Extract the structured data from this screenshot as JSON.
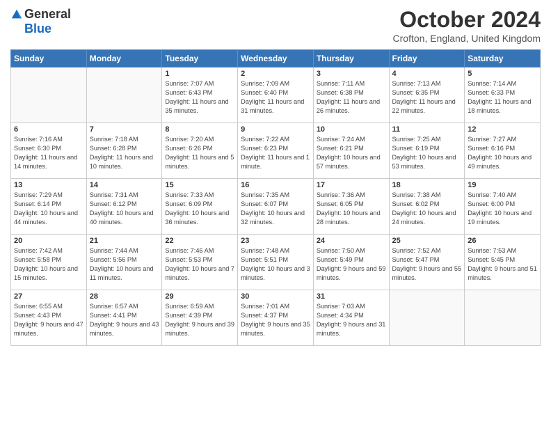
{
  "logo": {
    "general": "General",
    "blue": "Blue"
  },
  "title": "October 2024",
  "location": "Crofton, England, United Kingdom",
  "days_of_week": [
    "Sunday",
    "Monday",
    "Tuesday",
    "Wednesday",
    "Thursday",
    "Friday",
    "Saturday"
  ],
  "weeks": [
    [
      {
        "day": "",
        "info": ""
      },
      {
        "day": "",
        "info": ""
      },
      {
        "day": "1",
        "info": "Sunrise: 7:07 AM\nSunset: 6:43 PM\nDaylight: 11 hours and 35 minutes."
      },
      {
        "day": "2",
        "info": "Sunrise: 7:09 AM\nSunset: 6:40 PM\nDaylight: 11 hours and 31 minutes."
      },
      {
        "day": "3",
        "info": "Sunrise: 7:11 AM\nSunset: 6:38 PM\nDaylight: 11 hours and 26 minutes."
      },
      {
        "day": "4",
        "info": "Sunrise: 7:13 AM\nSunset: 6:35 PM\nDaylight: 11 hours and 22 minutes."
      },
      {
        "day": "5",
        "info": "Sunrise: 7:14 AM\nSunset: 6:33 PM\nDaylight: 11 hours and 18 minutes."
      }
    ],
    [
      {
        "day": "6",
        "info": "Sunrise: 7:16 AM\nSunset: 6:30 PM\nDaylight: 11 hours and 14 minutes."
      },
      {
        "day": "7",
        "info": "Sunrise: 7:18 AM\nSunset: 6:28 PM\nDaylight: 11 hours and 10 minutes."
      },
      {
        "day": "8",
        "info": "Sunrise: 7:20 AM\nSunset: 6:26 PM\nDaylight: 11 hours and 5 minutes."
      },
      {
        "day": "9",
        "info": "Sunrise: 7:22 AM\nSunset: 6:23 PM\nDaylight: 11 hours and 1 minute."
      },
      {
        "day": "10",
        "info": "Sunrise: 7:24 AM\nSunset: 6:21 PM\nDaylight: 10 hours and 57 minutes."
      },
      {
        "day": "11",
        "info": "Sunrise: 7:25 AM\nSunset: 6:19 PM\nDaylight: 10 hours and 53 minutes."
      },
      {
        "day": "12",
        "info": "Sunrise: 7:27 AM\nSunset: 6:16 PM\nDaylight: 10 hours and 49 minutes."
      }
    ],
    [
      {
        "day": "13",
        "info": "Sunrise: 7:29 AM\nSunset: 6:14 PM\nDaylight: 10 hours and 44 minutes."
      },
      {
        "day": "14",
        "info": "Sunrise: 7:31 AM\nSunset: 6:12 PM\nDaylight: 10 hours and 40 minutes."
      },
      {
        "day": "15",
        "info": "Sunrise: 7:33 AM\nSunset: 6:09 PM\nDaylight: 10 hours and 36 minutes."
      },
      {
        "day": "16",
        "info": "Sunrise: 7:35 AM\nSunset: 6:07 PM\nDaylight: 10 hours and 32 minutes."
      },
      {
        "day": "17",
        "info": "Sunrise: 7:36 AM\nSunset: 6:05 PM\nDaylight: 10 hours and 28 minutes."
      },
      {
        "day": "18",
        "info": "Sunrise: 7:38 AM\nSunset: 6:02 PM\nDaylight: 10 hours and 24 minutes."
      },
      {
        "day": "19",
        "info": "Sunrise: 7:40 AM\nSunset: 6:00 PM\nDaylight: 10 hours and 19 minutes."
      }
    ],
    [
      {
        "day": "20",
        "info": "Sunrise: 7:42 AM\nSunset: 5:58 PM\nDaylight: 10 hours and 15 minutes."
      },
      {
        "day": "21",
        "info": "Sunrise: 7:44 AM\nSunset: 5:56 PM\nDaylight: 10 hours and 11 minutes."
      },
      {
        "day": "22",
        "info": "Sunrise: 7:46 AM\nSunset: 5:53 PM\nDaylight: 10 hours and 7 minutes."
      },
      {
        "day": "23",
        "info": "Sunrise: 7:48 AM\nSunset: 5:51 PM\nDaylight: 10 hours and 3 minutes."
      },
      {
        "day": "24",
        "info": "Sunrise: 7:50 AM\nSunset: 5:49 PM\nDaylight: 9 hours and 59 minutes."
      },
      {
        "day": "25",
        "info": "Sunrise: 7:52 AM\nSunset: 5:47 PM\nDaylight: 9 hours and 55 minutes."
      },
      {
        "day": "26",
        "info": "Sunrise: 7:53 AM\nSunset: 5:45 PM\nDaylight: 9 hours and 51 minutes."
      }
    ],
    [
      {
        "day": "27",
        "info": "Sunrise: 6:55 AM\nSunset: 4:43 PM\nDaylight: 9 hours and 47 minutes."
      },
      {
        "day": "28",
        "info": "Sunrise: 6:57 AM\nSunset: 4:41 PM\nDaylight: 9 hours and 43 minutes."
      },
      {
        "day": "29",
        "info": "Sunrise: 6:59 AM\nSunset: 4:39 PM\nDaylight: 9 hours and 39 minutes."
      },
      {
        "day": "30",
        "info": "Sunrise: 7:01 AM\nSunset: 4:37 PM\nDaylight: 9 hours and 35 minutes."
      },
      {
        "day": "31",
        "info": "Sunrise: 7:03 AM\nSunset: 4:34 PM\nDaylight: 9 hours and 31 minutes."
      },
      {
        "day": "",
        "info": ""
      },
      {
        "day": "",
        "info": ""
      }
    ]
  ]
}
